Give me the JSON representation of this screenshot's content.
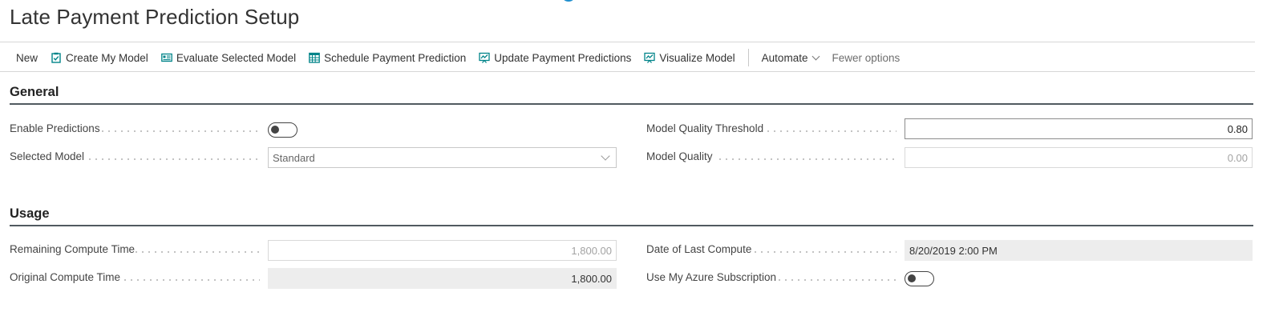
{
  "page": {
    "title": "Late Payment Prediction Setup"
  },
  "toolbar": {
    "new_label": "New",
    "create_model_label": "Create My Model",
    "evaluate_model_label": "Evaluate Selected Model",
    "schedule_prediction_label": "Schedule Payment Prediction",
    "update_predictions_label": "Update Payment Predictions",
    "visualize_model_label": "Visualize Model",
    "automate_label": "Automate",
    "fewer_options_label": "Fewer options",
    "icon_color": "#008489"
  },
  "general": {
    "title": "General",
    "enable_predictions": {
      "label": "Enable Predictions",
      "value": false
    },
    "selected_model": {
      "label": "Selected Model",
      "value": "Standard"
    },
    "model_quality_threshold": {
      "label": "Model Quality Threshold",
      "value": "0.80"
    },
    "model_quality": {
      "label": "Model Quality",
      "value": "0.00"
    }
  },
  "usage": {
    "title": "Usage",
    "remaining_compute_time": {
      "label": "Remaining Compute Time",
      "value": "1,800.00"
    },
    "original_compute_time": {
      "label": "Original Compute Time",
      "value": "1,800.00"
    },
    "date_of_last_compute": {
      "label": "Date of Last Compute",
      "value": "8/20/2019 2:00 PM"
    },
    "use_my_azure_subscription": {
      "label": "Use My Azure Subscription",
      "value": false
    }
  }
}
